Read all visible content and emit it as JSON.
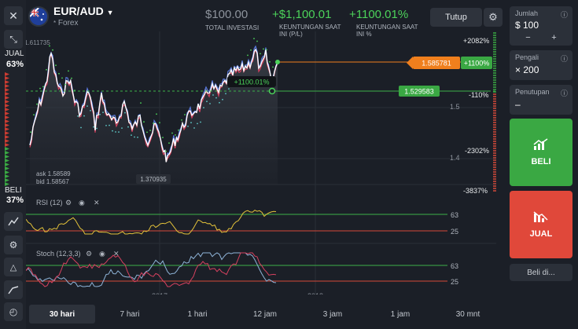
{
  "header": {
    "asset": "EUR/AUD",
    "asset_type": "Forex",
    "investment_value": "$100.00",
    "investment_caption": "TOTAL INVESTASI",
    "profit_value": "+$1,100.01",
    "profit_caption_1": "KEUNTUNGAN SAAT",
    "profit_caption_2": "INI (P/L)",
    "profit_pct_value": "+1100.01%",
    "profit_pct_caption_1": "KEUNTUNGAN SAAT",
    "profit_pct_caption_2": "INI %",
    "close_button": "Tutup"
  },
  "sentiment": {
    "sell_label": "JUAL",
    "sell_pct": "63%",
    "buy_label": "BELI",
    "buy_pct": "37%"
  },
  "chart": {
    "top_price_label": "1.611735",
    "low_price_label": "1.370935",
    "ask": "ask 1.58589",
    "bid": "bid 1.58567",
    "current_price": "1.585781",
    "current_pct": "+1100%",
    "entry_price": "1.529583",
    "trade_badge": "+1100.01%",
    "axis_levels": [
      "+2082%",
      "-110%",
      "1.5",
      "-2302%",
      "1.4",
      "-3837%"
    ],
    "x_labels": [
      "2017",
      "2018"
    ],
    "rsi_label": "RSI (12)",
    "rsi_levels": [
      "63",
      "25"
    ],
    "stoch_label": "Stoch (12,3,3)",
    "stoch_levels": [
      "63",
      "25"
    ]
  },
  "panel": {
    "amount_caption": "Jumlah",
    "amount_value": "$ 100",
    "multiplier_caption": "Pengali",
    "multiplier_value": "× 200",
    "closing_caption": "Penutupan",
    "closing_value": "–",
    "buy_button": "BELI",
    "sell_button": "JUAL",
    "buy_at": "Beli di..."
  },
  "timeframes": [
    "30 hari",
    "7 hari",
    "1 hari",
    "12 jam",
    "3 jam",
    "1 jam",
    "30 mnt"
  ],
  "active_timeframe": "30 hari",
  "colors": {
    "buy": "#3aa843",
    "sell": "#e0483a",
    "accent_green": "#4cd35a",
    "accent_orange": "#f07f1d",
    "price_line": "#ffffff",
    "rsi_line": "#e3c23a"
  }
}
